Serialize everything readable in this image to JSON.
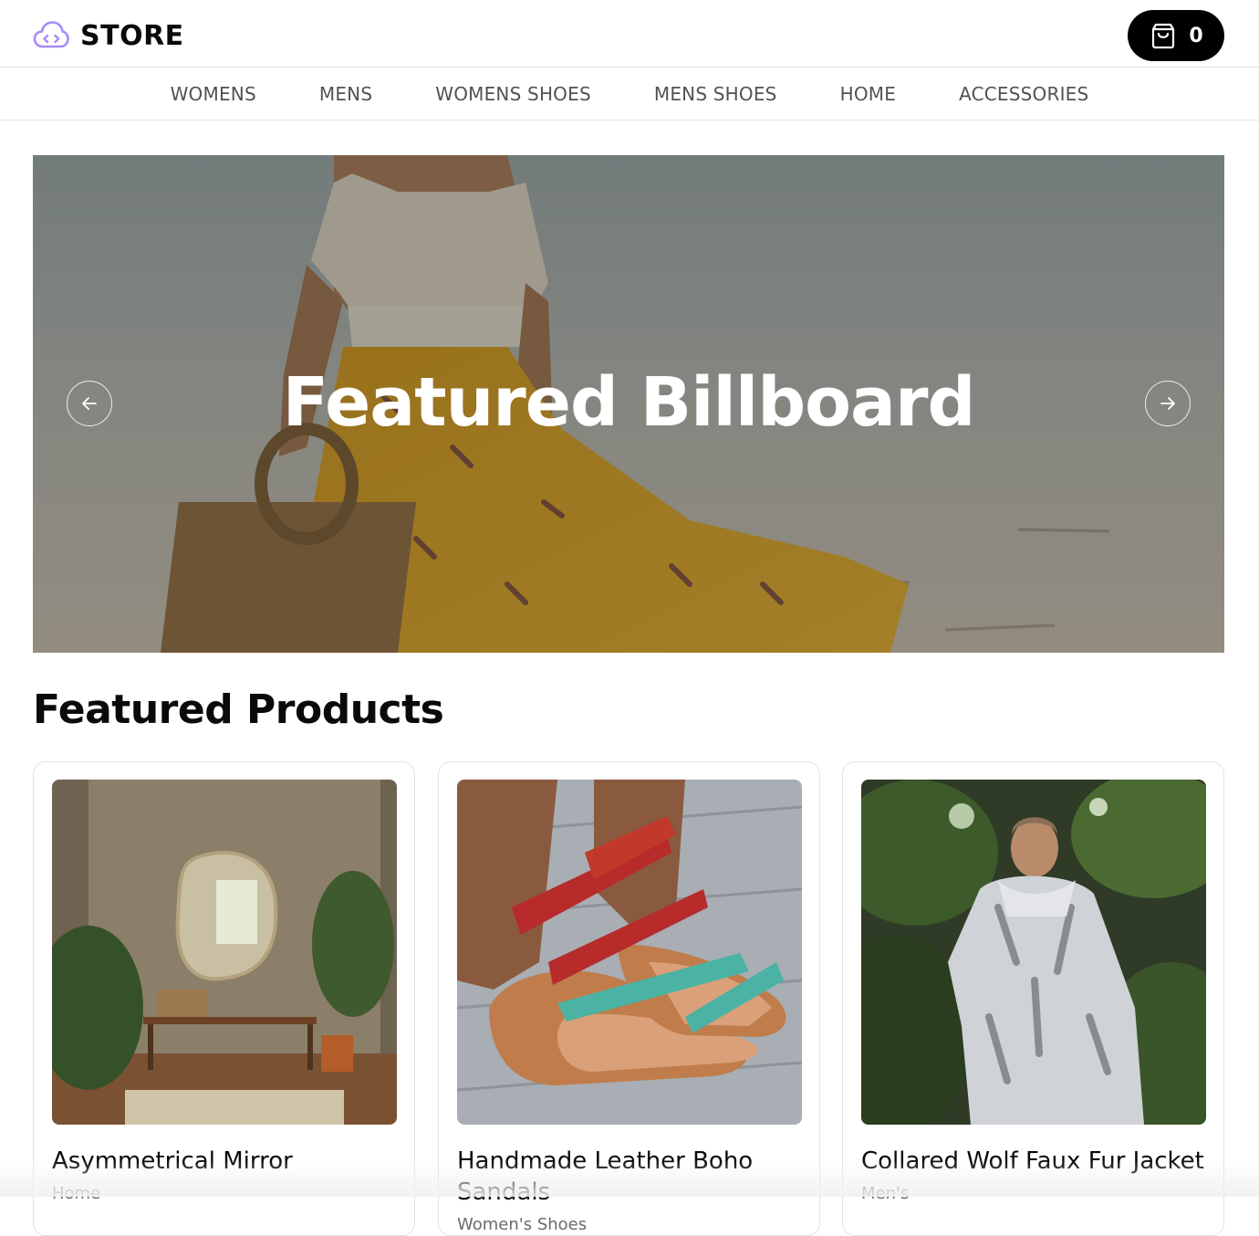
{
  "header": {
    "brand": "STORE",
    "brand_icon": "cloud-code-icon",
    "brand_color": "#a78bfa",
    "cart": {
      "icon": "shopping-bag-icon",
      "count": "0"
    }
  },
  "nav": {
    "items": [
      {
        "label": "WOMENS"
      },
      {
        "label": "MENS"
      },
      {
        "label": "WOMENS SHOES"
      },
      {
        "label": "MENS SHOES"
      },
      {
        "label": "HOME"
      },
      {
        "label": "ACCESSORIES"
      }
    ]
  },
  "billboard": {
    "title": "Featured Billboard",
    "prev_icon": "arrow-left-icon",
    "next_icon": "arrow-right-icon"
  },
  "featured": {
    "title": "Featured Products",
    "products": [
      {
        "name": "Asymmetrical Mirror",
        "category": "Home"
      },
      {
        "name": "Handmade Leather Boho Sandals",
        "category": "Women's Shoes"
      },
      {
        "name": "Collared Wolf Faux Fur Jacket",
        "category": "Men's"
      }
    ]
  }
}
